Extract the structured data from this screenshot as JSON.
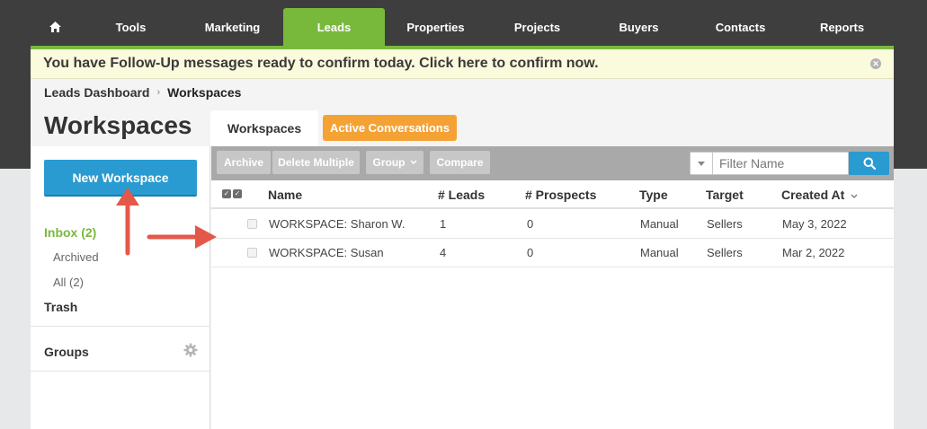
{
  "nav": {
    "items": [
      {
        "label": "Tools"
      },
      {
        "label": "Marketing"
      },
      {
        "label": "Leads"
      },
      {
        "label": "Properties"
      },
      {
        "label": "Projects"
      },
      {
        "label": "Buyers"
      },
      {
        "label": "Contacts"
      },
      {
        "label": "Reports"
      }
    ],
    "active": "Leads",
    "home_icon": "home-icon"
  },
  "banner": {
    "text": "You have Follow-Up messages ready to confirm today. Click here to confirm now.",
    "close_icon": "close-icon"
  },
  "breadcrumb": {
    "parent": "Leads Dashboard",
    "separator": "›",
    "current": "Workspaces"
  },
  "page": {
    "title": "Workspaces"
  },
  "tabs": {
    "workspaces": "Workspaces",
    "active_conversations": "Active Conversations"
  },
  "sidebar": {
    "new_workspace": "New Workspace",
    "inbox": "Inbox (2)",
    "archived": "Archived",
    "all": "All (2)",
    "trash": "Trash",
    "groups": "Groups",
    "groups_icon": "gear-icon"
  },
  "toolbar": {
    "archive": "Archive",
    "delete_multiple": "Delete Multiple",
    "group": "Group",
    "compare": "Compare",
    "filter_placeholder": "Filter Name",
    "search_icon": "search-icon"
  },
  "table": {
    "columns": {
      "name": "Name",
      "leads": "# Leads",
      "prospects": "# Prospects",
      "type": "Type",
      "target": "Target",
      "created_at": "Created At"
    },
    "rows": [
      {
        "name": "WORKSPACE: Sharon W.",
        "leads": "1",
        "prospects": "0",
        "type": "Manual",
        "target": "Sellers",
        "created_at": "May 3, 2022"
      },
      {
        "name": "WORKSPACE: Susan",
        "leads": "4",
        "prospects": "0",
        "type": "Manual",
        "target": "Sellers",
        "created_at": "Mar 2, 2022"
      }
    ]
  },
  "colors": {
    "nav_bg": "#3e3e3e",
    "accent_green": "#78b93c",
    "primary_blue": "#2a9bd1",
    "orange": "#f5a234",
    "annotation_arrow": "#e4584a"
  }
}
